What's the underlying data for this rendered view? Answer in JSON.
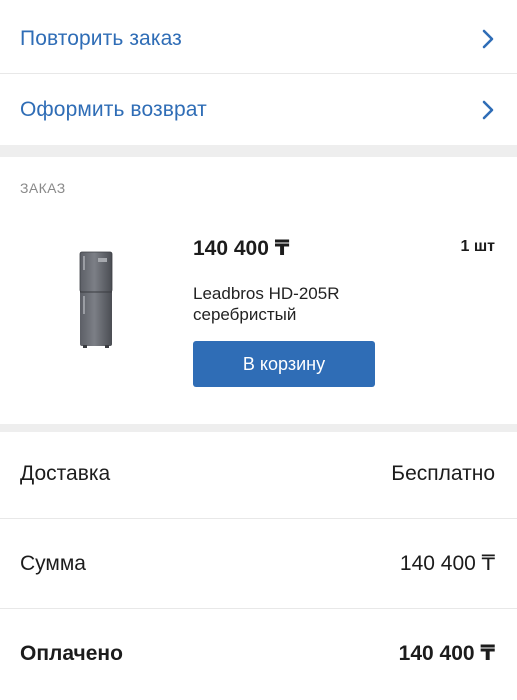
{
  "actions": {
    "repeat_order": "Повторить заказ",
    "return_order": "Оформить возврат"
  },
  "order": {
    "caption": "ЗАКАЗ",
    "item": {
      "price": "140 400 ₸",
      "quantity": "1 шт",
      "name": "Leadbros HD-205R серебристый",
      "add_to_cart_label": "В корзину",
      "image_icon": "refrigerator-icon"
    }
  },
  "summary": {
    "delivery_label": "Доставка",
    "delivery_value": "Бесплатно",
    "total_label": "Сумма",
    "total_value": "140 400 ₸",
    "paid_label": "Оплачено",
    "paid_value": "140 400 ₸"
  },
  "colors": {
    "accent": "#2f6db6",
    "section_gap": "#eeeeee",
    "divider": "#e8e8e8"
  }
}
